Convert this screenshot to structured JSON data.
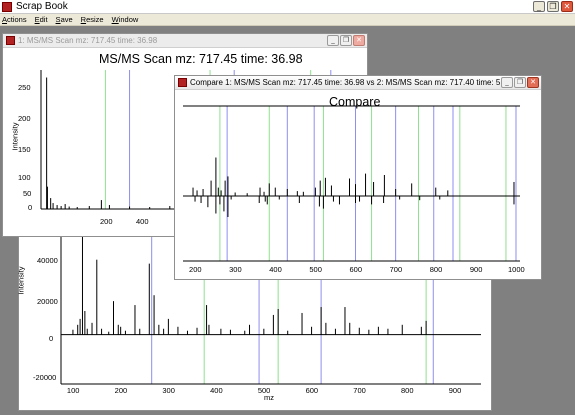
{
  "app": {
    "title": "Scrap Book",
    "menu": [
      "Actions",
      "Edit",
      "Save",
      "Resize",
      "Window"
    ],
    "caption_buttons": {
      "minimize": "_",
      "restore": "❐",
      "close": "✕"
    }
  },
  "windows": {
    "scan": {
      "title": "1: MS/MS Scan mz: 717.45 time: 36.98",
      "plot_title": "MS/MS Scan mz: 717.45 time: 36.98",
      "ylabel": "Intensity",
      "yticks": [
        "250",
        "200",
        "150",
        "100",
        "50",
        "0"
      ],
      "xticks": [
        "200",
        "400"
      ]
    },
    "bottom_plot": {
      "ylabel": "Intensity",
      "xlabel": "mz",
      "yticks": [
        "40000",
        "20000",
        "0",
        "-20000"
      ],
      "xticks": [
        "100",
        "200",
        "300",
        "400",
        "500",
        "600",
        "700",
        "800",
        "900"
      ]
    },
    "compare": {
      "title": "Compare 1: MS/MS Scan mz: 717.45 time: 36.98 vs 2: MS/MS Scan mz: 717.40 time: 5...",
      "plot_title": "Compare",
      "xticks": [
        "200",
        "300",
        "400",
        "500",
        "600",
        "700",
        "800",
        "900",
        "1000"
      ]
    }
  },
  "colors": {
    "green_marker": "#8fe08f",
    "blue_marker": "#8e8ef0",
    "peak": "#000000"
  },
  "chart_data": [
    {
      "type": "bar",
      "title": "MS/MS Scan mz: 717.45 time: 36.98",
      "ylabel": "Intensity",
      "ylim": [
        0,
        280
      ],
      "xlim": [
        40,
        440
      ],
      "green_markers": [
        120,
        250,
        375
      ],
      "blue_markers": [
        150,
        280,
        400
      ],
      "peaks": [
        {
          "x": 47,
          "y": 265
        },
        {
          "x": 48,
          "y": 45
        },
        {
          "x": 52,
          "y": 22
        },
        {
          "x": 55,
          "y": 12
        },
        {
          "x": 60,
          "y": 8
        },
        {
          "x": 65,
          "y": 6
        },
        {
          "x": 70,
          "y": 10
        },
        {
          "x": 75,
          "y": 5
        },
        {
          "x": 85,
          "y": 4
        },
        {
          "x": 100,
          "y": 6
        },
        {
          "x": 115,
          "y": 18
        },
        {
          "x": 125,
          "y": 8
        },
        {
          "x": 150,
          "y": 5
        },
        {
          "x": 175,
          "y": 4
        },
        {
          "x": 200,
          "y": 6
        },
        {
          "x": 230,
          "y": 3
        },
        {
          "x": 263,
          "y": 48
        },
        {
          "x": 270,
          "y": 10
        },
        {
          "x": 300,
          "y": 5
        },
        {
          "x": 330,
          "y": 4
        },
        {
          "x": 365,
          "y": 6
        },
        {
          "x": 405,
          "y": 3
        }
      ]
    },
    {
      "type": "bar",
      "ylabel": "Intensity",
      "xlabel": "mz",
      "ylim": [
        -25000,
        50000
      ],
      "xlim": [
        75,
        955
      ],
      "green_markers": [
        375,
        530,
        840
      ],
      "blue_markers": [
        265,
        490,
        620,
        855
      ],
      "peaks": [
        {
          "x": 100,
          "y": 2500
        },
        {
          "x": 110,
          "y": 5000
        },
        {
          "x": 115,
          "y": 8000
        },
        {
          "x": 120,
          "y": 50000
        },
        {
          "x": 125,
          "y": 12000
        },
        {
          "x": 130,
          "y": 3000
        },
        {
          "x": 140,
          "y": 6000
        },
        {
          "x": 150,
          "y": 38000
        },
        {
          "x": 160,
          "y": 3000
        },
        {
          "x": 175,
          "y": 1500
        },
        {
          "x": 185,
          "y": 17000
        },
        {
          "x": 195,
          "y": 5000
        },
        {
          "x": 200,
          "y": 4000
        },
        {
          "x": 210,
          "y": 2000
        },
        {
          "x": 230,
          "y": 15000
        },
        {
          "x": 240,
          "y": 3000
        },
        {
          "x": 260,
          "y": 36000
        },
        {
          "x": 270,
          "y": 20000
        },
        {
          "x": 280,
          "y": 5000
        },
        {
          "x": 290,
          "y": 3000
        },
        {
          "x": 300,
          "y": 8000
        },
        {
          "x": 320,
          "y": 4000
        },
        {
          "x": 340,
          "y": 2000
        },
        {
          "x": 360,
          "y": 3500
        },
        {
          "x": 380,
          "y": 15000
        },
        {
          "x": 385,
          "y": 5000
        },
        {
          "x": 410,
          "y": 3000
        },
        {
          "x": 430,
          "y": 2500
        },
        {
          "x": 460,
          "y": 2000
        },
        {
          "x": 470,
          "y": 5000
        },
        {
          "x": 500,
          "y": 3000
        },
        {
          "x": 520,
          "y": 10000
        },
        {
          "x": 530,
          "y": 13000
        },
        {
          "x": 550,
          "y": 2000
        },
        {
          "x": 580,
          "y": 11000
        },
        {
          "x": 600,
          "y": 4000
        },
        {
          "x": 620,
          "y": 14000
        },
        {
          "x": 630,
          "y": 6000
        },
        {
          "x": 650,
          "y": 3000
        },
        {
          "x": 670,
          "y": 14000
        },
        {
          "x": 680,
          "y": 6000
        },
        {
          "x": 700,
          "y": 3500
        },
        {
          "x": 720,
          "y": 2500
        },
        {
          "x": 740,
          "y": 4000
        },
        {
          "x": 760,
          "y": 3000
        },
        {
          "x": 790,
          "y": 5000
        },
        {
          "x": 830,
          "y": 4000
        },
        {
          "x": 840,
          "y": 7000
        }
      ]
    },
    {
      "type": "bar",
      "title": "Compare",
      "xlim": [
        170,
        1010
      ],
      "ylim": [
        -1,
        1
      ],
      "green_markers": [
        262,
        385,
        520,
        640,
        757,
        860,
        975
      ],
      "blue_markers": [
        280,
        430,
        497,
        600,
        700,
        795,
        843,
        1000
      ],
      "peaks_top": [
        {
          "x": 195,
          "y": 0.12
        },
        {
          "x": 205,
          "y": 0.08
        },
        {
          "x": 220,
          "y": 0.1
        },
        {
          "x": 240,
          "y": 0.22
        },
        {
          "x": 252,
          "y": 0.55
        },
        {
          "x": 258,
          "y": 0.12
        },
        {
          "x": 265,
          "y": 0.08
        },
        {
          "x": 275,
          "y": 0.22
        },
        {
          "x": 282,
          "y": 0.28
        },
        {
          "x": 300,
          "y": 0.05
        },
        {
          "x": 330,
          "y": 0.04
        },
        {
          "x": 362,
          "y": 0.12
        },
        {
          "x": 372,
          "y": 0.06
        },
        {
          "x": 385,
          "y": 0.18
        },
        {
          "x": 400,
          "y": 0.12
        },
        {
          "x": 430,
          "y": 0.1
        },
        {
          "x": 455,
          "y": 0.07
        },
        {
          "x": 470,
          "y": 0.06
        },
        {
          "x": 500,
          "y": 0.12
        },
        {
          "x": 512,
          "y": 0.22
        },
        {
          "x": 525,
          "y": 0.26
        },
        {
          "x": 540,
          "y": 0.15
        },
        {
          "x": 585,
          "y": 0.25
        },
        {
          "x": 600,
          "y": 0.17
        },
        {
          "x": 625,
          "y": 0.32
        },
        {
          "x": 645,
          "y": 0.2
        },
        {
          "x": 672,
          "y": 0.3
        },
        {
          "x": 700,
          "y": 0.1
        },
        {
          "x": 740,
          "y": 0.18
        },
        {
          "x": 800,
          "y": 0.12
        },
        {
          "x": 830,
          "y": 0.08
        },
        {
          "x": 995,
          "y": 0.2
        }
      ],
      "peaks_bottom": [
        {
          "x": 200,
          "y": 0.08
        },
        {
          "x": 215,
          "y": 0.1
        },
        {
          "x": 232,
          "y": 0.16
        },
        {
          "x": 252,
          "y": 0.25
        },
        {
          "x": 262,
          "y": 0.12
        },
        {
          "x": 272,
          "y": 0.22
        },
        {
          "x": 282,
          "y": 0.3
        },
        {
          "x": 290,
          "y": 0.05
        },
        {
          "x": 360,
          "y": 0.1
        },
        {
          "x": 375,
          "y": 0.08
        },
        {
          "x": 380,
          "y": 0.12
        },
        {
          "x": 410,
          "y": 0.05
        },
        {
          "x": 460,
          "y": 0.1
        },
        {
          "x": 510,
          "y": 0.15
        },
        {
          "x": 520,
          "y": 0.18
        },
        {
          "x": 545,
          "y": 0.08
        },
        {
          "x": 560,
          "y": 0.12
        },
        {
          "x": 600,
          "y": 0.1
        },
        {
          "x": 610,
          "y": 0.08
        },
        {
          "x": 640,
          "y": 0.12
        },
        {
          "x": 670,
          "y": 0.1
        },
        {
          "x": 710,
          "y": 0.05
        },
        {
          "x": 760,
          "y": 0.06
        },
        {
          "x": 810,
          "y": 0.05
        },
        {
          "x": 995,
          "y": 0.12
        }
      ]
    }
  ]
}
